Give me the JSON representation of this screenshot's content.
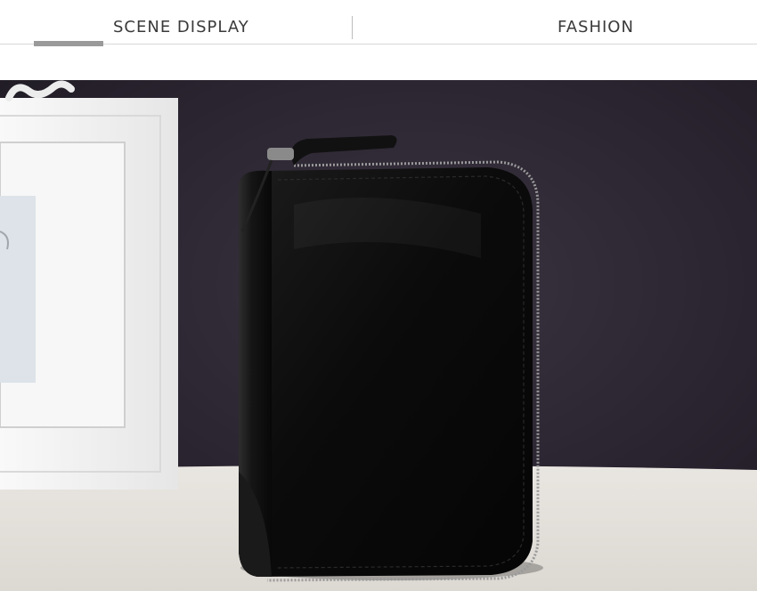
{
  "header": {
    "left_label": "SCENE DISPLAY",
    "right_label": "FASHION"
  },
  "photo": {
    "subject": "black-leather-zip-wallet",
    "colors": {
      "backdrop": "#2a2430",
      "table": "#e8e5e0",
      "frame": "#f4f4f4",
      "wallet": "#0c0c0c"
    }
  }
}
